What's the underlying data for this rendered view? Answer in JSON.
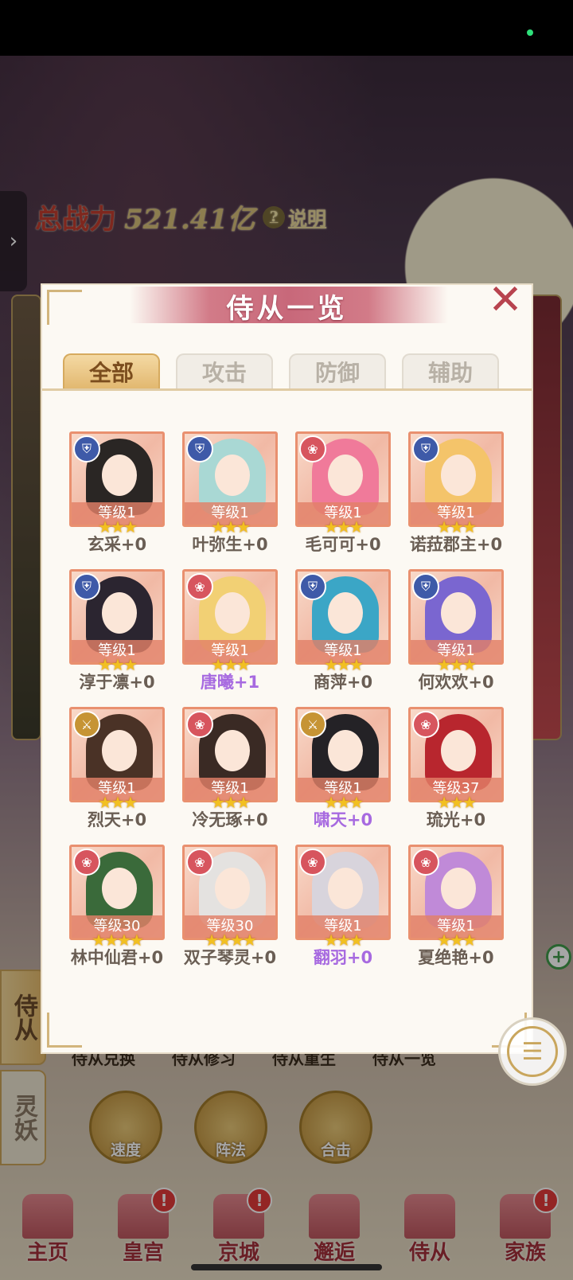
{
  "background": {
    "total_power_label": "总战力",
    "total_power_value": "521.41亿",
    "help_label": "说明"
  },
  "dialog": {
    "title": "侍从一览",
    "tabs": [
      {
        "label": "全部",
        "active": true
      },
      {
        "label": "攻击",
        "active": false
      },
      {
        "label": "防御",
        "active": false
      },
      {
        "label": "辅助",
        "active": false
      }
    ],
    "cards": [
      {
        "name": "玄采+0",
        "level": "等级1",
        "stars": 3,
        "type": "defense",
        "hair": "#2a2624",
        "highlight": false
      },
      {
        "name": "叶弥生+0",
        "level": "等级1",
        "stars": 3,
        "type": "defense",
        "hair": "#a9d8d4",
        "highlight": false
      },
      {
        "name": "毛可可+0",
        "level": "等级1",
        "stars": 3,
        "type": "support",
        "hair": "#f07a9a",
        "highlight": false
      },
      {
        "name": "诺菈郡主+0",
        "level": "等级1",
        "stars": 3,
        "type": "defense",
        "hair": "#f4c46a",
        "highlight": false
      },
      {
        "name": "淳于凛+0",
        "level": "等级1",
        "stars": 3,
        "type": "defense",
        "hair": "#2b2530",
        "highlight": false
      },
      {
        "name": "唐曦+1",
        "level": "等级1",
        "stars": 3,
        "type": "support",
        "hair": "#f2d074",
        "highlight": true
      },
      {
        "name": "商萍+0",
        "level": "等级1",
        "stars": 3,
        "type": "defense",
        "hair": "#3ba6c6",
        "highlight": false
      },
      {
        "name": "何欢欢+0",
        "level": "等级1",
        "stars": 3,
        "type": "defense",
        "hair": "#7a66d0",
        "highlight": false
      },
      {
        "name": "烈天+0",
        "level": "等级1",
        "stars": 3,
        "type": "attack",
        "hair": "#4a3226",
        "highlight": false
      },
      {
        "name": "冷无琢+0",
        "level": "等级1",
        "stars": 3,
        "type": "support",
        "hair": "#3a2a24",
        "highlight": false
      },
      {
        "name": "啸天+0",
        "level": "等级1",
        "stars": 3,
        "type": "attack",
        "hair": "#242226",
        "highlight": true
      },
      {
        "name": "琉光+0",
        "level": "等级37",
        "stars": 3,
        "type": "support",
        "hair": "#b8262e",
        "highlight": false
      },
      {
        "name": "林中仙君+0",
        "level": "等级30",
        "stars": 4,
        "type": "support",
        "hair": "#3a6a3a",
        "highlight": false
      },
      {
        "name": "双子琴灵+0",
        "level": "等级30",
        "stars": 4,
        "type": "support",
        "hair": "#e4e2e0",
        "highlight": false
      },
      {
        "name": "翻羽+0",
        "level": "等级1",
        "stars": 3,
        "type": "support",
        "hair": "#d8d4dc",
        "highlight": true
      },
      {
        "name": "夏绝艳+0",
        "level": "等级1",
        "stars": 3,
        "type": "support",
        "hair": "#c08ad8",
        "highlight": false
      },
      {
        "name": "",
        "level": "",
        "stars": 0,
        "type": "attack",
        "hair": "#f2b6c0",
        "highlight": false
      },
      {
        "name": "",
        "level": "",
        "stars": 0,
        "type": "support",
        "hair": "#e88a80",
        "highlight": false
      },
      {
        "name": "",
        "level": "",
        "stars": 0,
        "type": "support",
        "hair": "#7ec8d8",
        "highlight": false
      },
      {
        "name": "",
        "level": "",
        "stars": 0,
        "type": "support",
        "hair": "#d8a868",
        "highlight": false
      }
    ]
  },
  "side_tabs": [
    {
      "label": "侍从",
      "active": true
    },
    {
      "label": "灵妖",
      "active": false
    }
  ],
  "shortcuts": [
    "侍从兑换",
    "侍从修习",
    "侍从重生",
    "侍从一览"
  ],
  "round_buttons": [
    "速度",
    "阵法",
    "合击"
  ],
  "bottom_nav": [
    {
      "label": "主页",
      "badge": ""
    },
    {
      "label": "皇宫",
      "badge": "!"
    },
    {
      "label": "京城",
      "badge": "!"
    },
    {
      "label": "邂逅",
      "badge": ""
    },
    {
      "label": "侍从",
      "badge": ""
    },
    {
      "label": "家族",
      "badge": "!"
    }
  ],
  "colors": {
    "defense": "#3e5aa8",
    "support": "#d7555e",
    "attack": "#c69434",
    "highlight_name": "#a76ae0"
  }
}
